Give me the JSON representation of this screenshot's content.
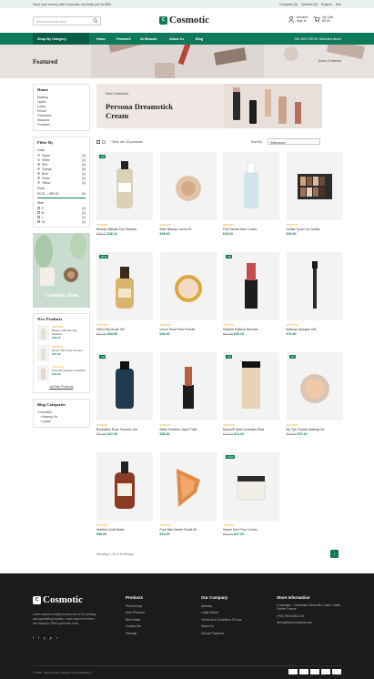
{
  "topbar": {
    "promo": "Save your money with Cosmotic, try today just for $59.",
    "links": [
      "Compare (0)",
      "Wishlist (0)",
      "English",
      "Ksh"
    ]
  },
  "header": {
    "search_placeholder": "Search products here...",
    "logo": "Cosmotic",
    "account": {
      "line1": "Account",
      "line2": "Sign In"
    },
    "cart": {
      "line1": "My Cart",
      "line2": "€0.00"
    }
  },
  "nav": {
    "category": "Shop By Category",
    "items": [
      "Home",
      "Featured",
      "All Brands",
      "About Us",
      "Blog"
    ],
    "offer": "Get 30% Off On Selected Items"
  },
  "banner": {
    "title": "Featured",
    "breadcrumb": "Home | Featured"
  },
  "sidebar": {
    "home": {
      "title": "Home",
      "items": [
        "Makeup",
        "Lipstic",
        "Lotion",
        "Primer",
        "Facewash",
        "Mascara",
        "Featured"
      ]
    },
    "filter": {
      "title": "Filter By",
      "color_label": "Color",
      "colors": [
        {
          "name": "Taupe",
          "count": "(3)",
          "hex": "#c8b08a"
        },
        {
          "name": "White",
          "count": "(4)",
          "hex": "#ffffff"
        },
        {
          "name": "Red",
          "count": "(8)",
          "hex": "#d62828"
        },
        {
          "name": "Orange",
          "count": "(8)",
          "hex": "#f28c28"
        },
        {
          "name": "Blue",
          "count": "(4)",
          "hex": "#2f6fd6"
        },
        {
          "name": "Green",
          "count": "(4)",
          "hex": "#2e9e4f"
        },
        {
          "name": "Yellow",
          "count": "(4)",
          "hex": "#f2c94c"
        }
      ],
      "price_label": "Price",
      "price_min": "€0.00 — €60.00",
      "price_max": "(5)",
      "size_label": "Size",
      "sizes": [
        {
          "name": "S",
          "count": "(4)"
        },
        {
          "name": "M",
          "count": "(3)"
        },
        {
          "name": "L",
          "count": "(2)"
        },
        {
          "name": "XL",
          "count": "(1)"
        }
      ]
    },
    "ad_caption": "Cosmetic Item",
    "new_products": {
      "title": "New Products",
      "items": [
        {
          "name": "Beauty Ultimate Eye Shadow",
          "price": "€43.75"
        },
        {
          "name": "Pense Skin Prep Combo",
          "price": "€47.43"
        },
        {
          "name": "Pure Skin Nearin Facial Kit",
          "price": "€74.00"
        }
      ],
      "all_link": "All New Products"
    },
    "blog_categories": {
      "title": "Blog Categories",
      "items": [
        "Cosmetics",
        "Makeup Kit",
        "Lipstic"
      ]
    }
  },
  "hero": {
    "subtitle": "New Collection",
    "title": "Persona Dreamstick Cream"
  },
  "toolbar": {
    "count_text": "There are 15 products.",
    "sort_label": "Sort By:",
    "sort_value": "Relevance"
  },
  "products": [
    {
      "name": "Beauty Ultimate Eye Shadow",
      "old": "€58.37",
      "price": "€46.12",
      "badge": "-8%"
    },
    {
      "name": "Bolin Beauty Canon Kit",
      "old": "",
      "price": "€38.00",
      "badge": ""
    },
    {
      "name": "Fish Renew Skin Combo",
      "old": "",
      "price": "€15.00",
      "badge": ""
    },
    {
      "name": "Guitab Touch Up Combo",
      "old": "",
      "price": "€43.00",
      "badge": ""
    },
    {
      "name": "Hello Kitty Brush Set",
      "old": "€34.32",
      "price": "€30.90",
      "badge": "-€4.00"
    },
    {
      "name": "Urnne Rose Face Powder",
      "old": "",
      "price": "€46.00",
      "badge": ""
    },
    {
      "name": "Marplus Makeup Brushes",
      "old": "€84.09",
      "price": "€16.26",
      "badge": "-5%"
    },
    {
      "name": "Makeup Sponges Kits",
      "old": "",
      "price": "€79.80",
      "badge": ""
    },
    {
      "name": "Borealskin Rose Turmeric Gel",
      "old": "€51.68",
      "price": "€47.43",
      "badge": "-7%"
    },
    {
      "name": "Matte Fearless Liquid Tube",
      "old": "",
      "price": "€53.00",
      "badge": ""
    },
    {
      "name": "MenoUP Matt Concealer Stick",
      "old": "€22.83",
      "price": "€12.20",
      "badge": "-5%"
    },
    {
      "name": "My Tye Fashion Makeup Kit",
      "old": "€58.08",
      "price": "€47.43",
      "badge": "-3%"
    },
    {
      "name": "Nutrition Gold Seeer",
      "old": "",
      "price": "€58.00",
      "badge": ""
    },
    {
      "name": "Pure Skin Nearin Facial Kit",
      "old": "",
      "price": "€74.00",
      "badge": ""
    },
    {
      "name": "Ranee Skin Prep Combo",
      "old": "€50.00",
      "price": "€47.00",
      "badge": "-€3.00"
    }
  ],
  "pagination": {
    "text": "Showing 1-15 of 15 item(s)",
    "next": "›"
  },
  "footer": {
    "logo": "Cosmotic",
    "description": "Lorem ipsum is simply dummy text of the printing and typesetting industry. Lorem ipsum has been the industrys 1500s specimen book.",
    "social": [
      "f",
      "t",
      "y",
      "p",
      "i"
    ],
    "products": {
      "title": "Products",
      "items": [
        "Prices Drop",
        "New Products",
        "Best Sales",
        "Contact Us",
        "Sitemap"
      ]
    },
    "company": {
      "title": "Our Company",
      "items": [
        "Delivery",
        "Legal Notice",
        "Terms And Conditions Of Use",
        "About Us",
        "Secure Payment"
      ]
    },
    "store": {
      "title": "Store Information",
      "items": [
        "Cosmotics - Cosmetics Store 561 Union Trade Centre France",
        "(+91) 9876-543-210",
        "demo@yourcompany.com"
      ]
    },
    "copyright": "© 2025 - Ecommerce software by PrestaShop™"
  }
}
